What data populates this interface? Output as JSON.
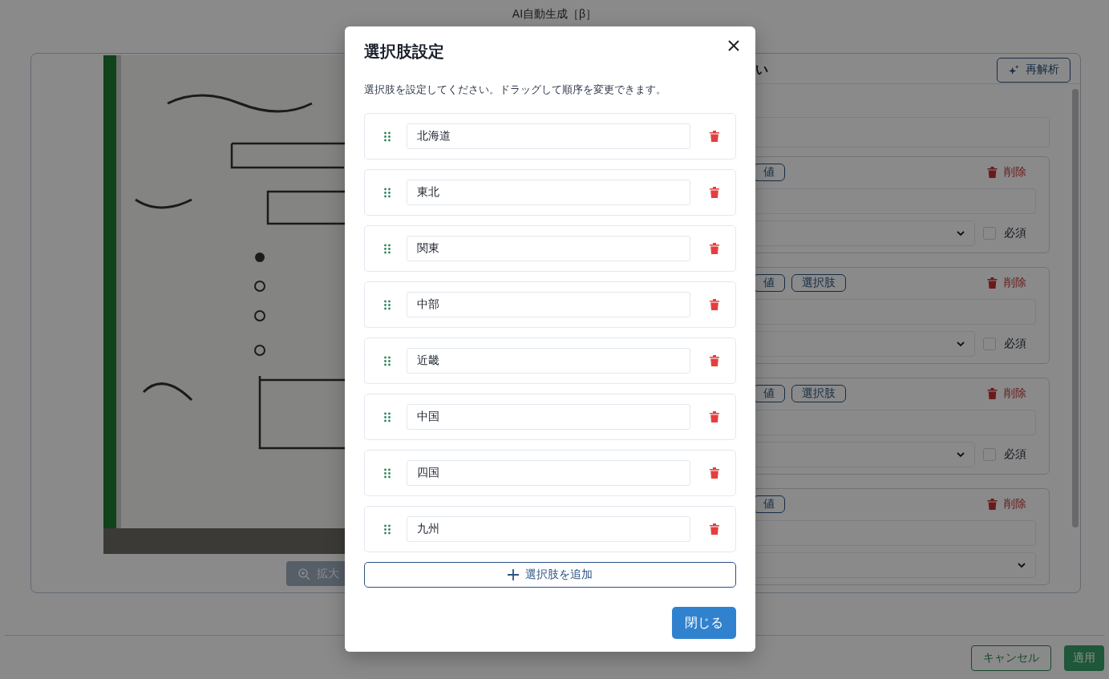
{
  "page_title": "AI自動生成［β］",
  "image_panel": {
    "zoom_button": "拡大"
  },
  "fields_panel": {
    "heading": "い",
    "reanalyze_button": "再解析",
    "cards": [
      {
        "tags": [
          "値"
        ],
        "delete_label": "削除",
        "required_label": "必須",
        "required": false
      },
      {
        "tags": [
          "値",
          "選択肢"
        ],
        "delete_label": "削除",
        "required_label": "必須",
        "required": false
      },
      {
        "tags": [
          "値",
          "選択肢"
        ],
        "delete_label": "削除",
        "required_label": "必須",
        "required": false
      },
      {
        "tags": [
          "値"
        ],
        "delete_label": "削除"
      }
    ]
  },
  "dialog": {
    "title": "選択肢設定",
    "description": "選択肢を設定してください。ドラッグして順序を変更できます。",
    "options": [
      "北海道",
      "東北",
      "関東",
      "中部",
      "近畿",
      "中国",
      "四国",
      "九州"
    ],
    "add_button": "選択肢を追加",
    "close_button": "閉じる"
  },
  "footer": {
    "cancel_button": "キャンセル",
    "apply_button": "適用"
  }
}
